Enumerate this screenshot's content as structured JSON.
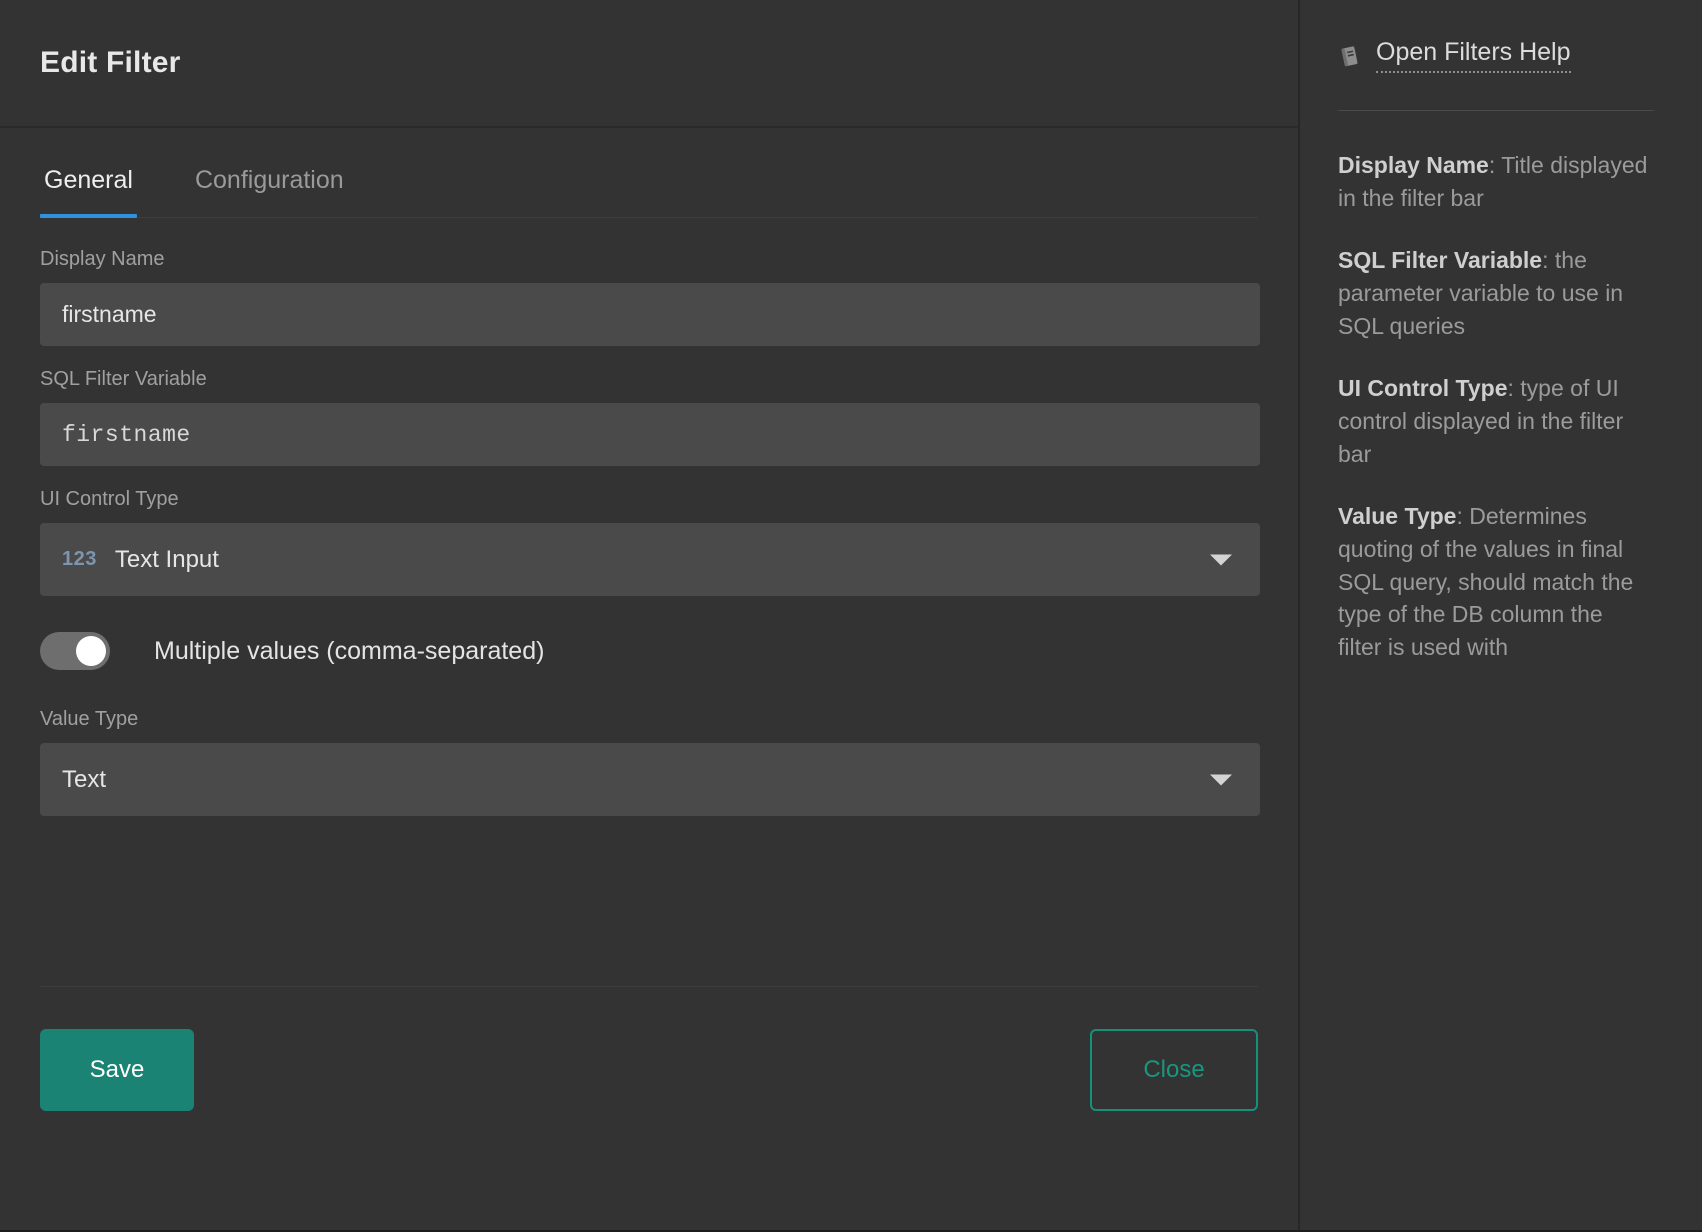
{
  "dialog": {
    "title": "Edit Filter"
  },
  "tabs": [
    {
      "label": "General",
      "active": true
    },
    {
      "label": "Configuration",
      "active": false
    }
  ],
  "form": {
    "display_name": {
      "label": "Display Name",
      "value": "firstname",
      "placeholder": ""
    },
    "sql_filter_variable": {
      "label": "SQL Filter Variable",
      "value": "firstname",
      "placeholder": ""
    },
    "ui_control_type": {
      "label": "UI Control Type",
      "icon": "123",
      "value": "Text Input",
      "caret_icon": "chevron-down-icon"
    },
    "multiple_values": {
      "label": "Multiple values (comma-separated)",
      "state": "on"
    },
    "value_type": {
      "label": "Value Type",
      "value": "Text",
      "caret_icon": "chevron-down-icon"
    }
  },
  "footer": {
    "save_label": "Save",
    "close_label": "Close"
  },
  "help": {
    "icon": "book-icon",
    "link_label": "Open Filters Help",
    "paragraphs": [
      {
        "term": "Display Name",
        "sep": ": ",
        "text": "Title displayed in the filter bar"
      },
      {
        "term": "SQL Filter Variable",
        "sep": ": ",
        "text": "the parameter variable to use in SQL queries"
      },
      {
        "term": "UI Control Type",
        "sep": ": ",
        "text": "type of UI control displayed in the filter bar"
      },
      {
        "term": "Value Type",
        "sep": ": ",
        "text": "Determines quoting of the values in final SQL query, should match the type of the DB column the filter is used with"
      }
    ]
  },
  "colors": {
    "accent_blue": "#3191dc",
    "accent_teal": "#1b8373",
    "panel_bg": "#333333",
    "input_bg": "#4a4a4a",
    "icon_123": "#7f95ad"
  }
}
